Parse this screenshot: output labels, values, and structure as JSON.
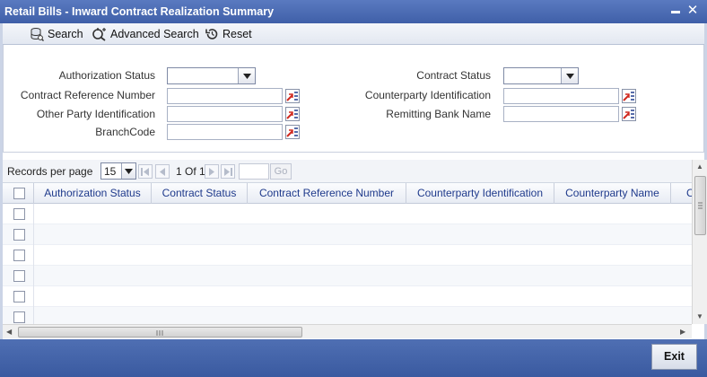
{
  "window": {
    "title": "Retail Bills - Inward Contract Realization Summary",
    "minimize_glyph": "▬",
    "close_glyph": "✕"
  },
  "toolbar": {
    "search": "Search",
    "advanced_search": "Advanced Search",
    "reset": "Reset"
  },
  "criteria": {
    "authorization_status": {
      "label": "Authorization Status",
      "value": ""
    },
    "contract_reference_number": {
      "label": "Contract Reference Number",
      "value": ""
    },
    "other_party_identification": {
      "label": "Other Party Identification",
      "value": ""
    },
    "branch_code": {
      "label": "BranchCode",
      "value": ""
    },
    "contract_status": {
      "label": "Contract Status",
      "value": ""
    },
    "counterparty_identification": {
      "label": "Counterparty Identification",
      "value": ""
    },
    "remitting_bank_name": {
      "label": "Remitting Bank Name",
      "value": ""
    }
  },
  "pager": {
    "records_per_page_label": "Records per page",
    "records_per_page_value": "15",
    "page_info": "1 Of 1",
    "goto_value": "",
    "go_label": "Go"
  },
  "grid": {
    "columns": [
      "Authorization Status",
      "Contract Status",
      "Contract Reference Number",
      "Counterparty Identification",
      "Counterparty Name",
      "C"
    ],
    "row_count": 6
  },
  "footer": {
    "exit_label": "Exit"
  },
  "colors": {
    "title_bar": "#4a6ab3",
    "column_header_text": "#1f3a8c",
    "footer_bar": "#4566ad"
  }
}
